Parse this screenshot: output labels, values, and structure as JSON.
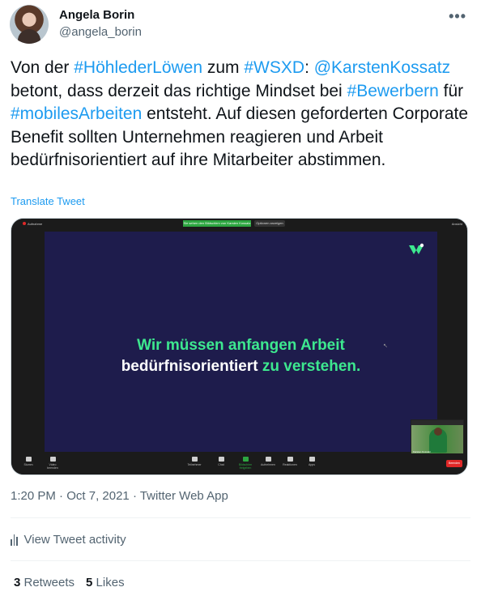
{
  "author": {
    "name": "Angela Borin",
    "handle": "@angela_borin"
  },
  "more_label": "•••",
  "tweet": {
    "segments": [
      {
        "t": "Von der ",
        "tag": false
      },
      {
        "t": "#HöhlederLöwen",
        "tag": true
      },
      {
        "t": " zum ",
        "tag": false
      },
      {
        "t": "#WSXD",
        "tag": true
      },
      {
        "t": ": ",
        "tag": false
      },
      {
        "t": "@KarstenKossatz",
        "tag": true
      },
      {
        "t": " betont, dass derzeit das richtige Mindset bei ",
        "tag": false
      },
      {
        "t": "#Bewerbern",
        "tag": true
      },
      {
        "t": " für ",
        "tag": false
      },
      {
        "t": "#mobilesArbeiten",
        "tag": true
      },
      {
        "t": " entsteht. Auf diesen geforderten Corporate Benefit sollten Unternehmen reagieren und Arbeit bedürfnisorientiert auf ihre Mitarbeiter abstimmen.",
        "tag": false
      }
    ]
  },
  "translate_label": "Translate Tweet",
  "media": {
    "recording_label": "Aufnahme",
    "banner_text": "Sie sehen den Bildschirm von Karsten Kossatz",
    "view_options": "Optionen anzeigen",
    "view_right": "Ansicht",
    "slide_line1": "Wir müssen anfangen Arbeit",
    "slide_line2_white": "bedürfnisorientiert",
    "slide_line2_green": " zu verstehen.",
    "pip_name": "Karsten Kossatz",
    "toolbar": [
      {
        "label": "Stumm",
        "green": false
      },
      {
        "label": "Video beenden",
        "green": false
      },
      {
        "label": "Teilnehmer",
        "green": false
      },
      {
        "label": "Chat",
        "green": false
      },
      {
        "label": "Bildschirm freigeben",
        "green": true
      },
      {
        "label": "Aufnehmen",
        "green": false
      },
      {
        "label": "Reaktionen",
        "green": false
      },
      {
        "label": "Apps",
        "green": false
      }
    ],
    "end_label": "Beenden"
  },
  "meta": {
    "time": "1:20 PM",
    "sep1": " · ",
    "date": "Oct 7, 2021",
    "sep2": " · ",
    "source": "Twitter Web App"
  },
  "activity_label": "View Tweet activity",
  "stats": {
    "retweets_count": "3",
    "retweets_label": " Retweets",
    "likes_count": "5",
    "likes_label": " Likes"
  },
  "colors": {
    "link": "#1d9bf0",
    "slide_bg": "#1e1c4c",
    "slide_green": "#3de88f"
  }
}
